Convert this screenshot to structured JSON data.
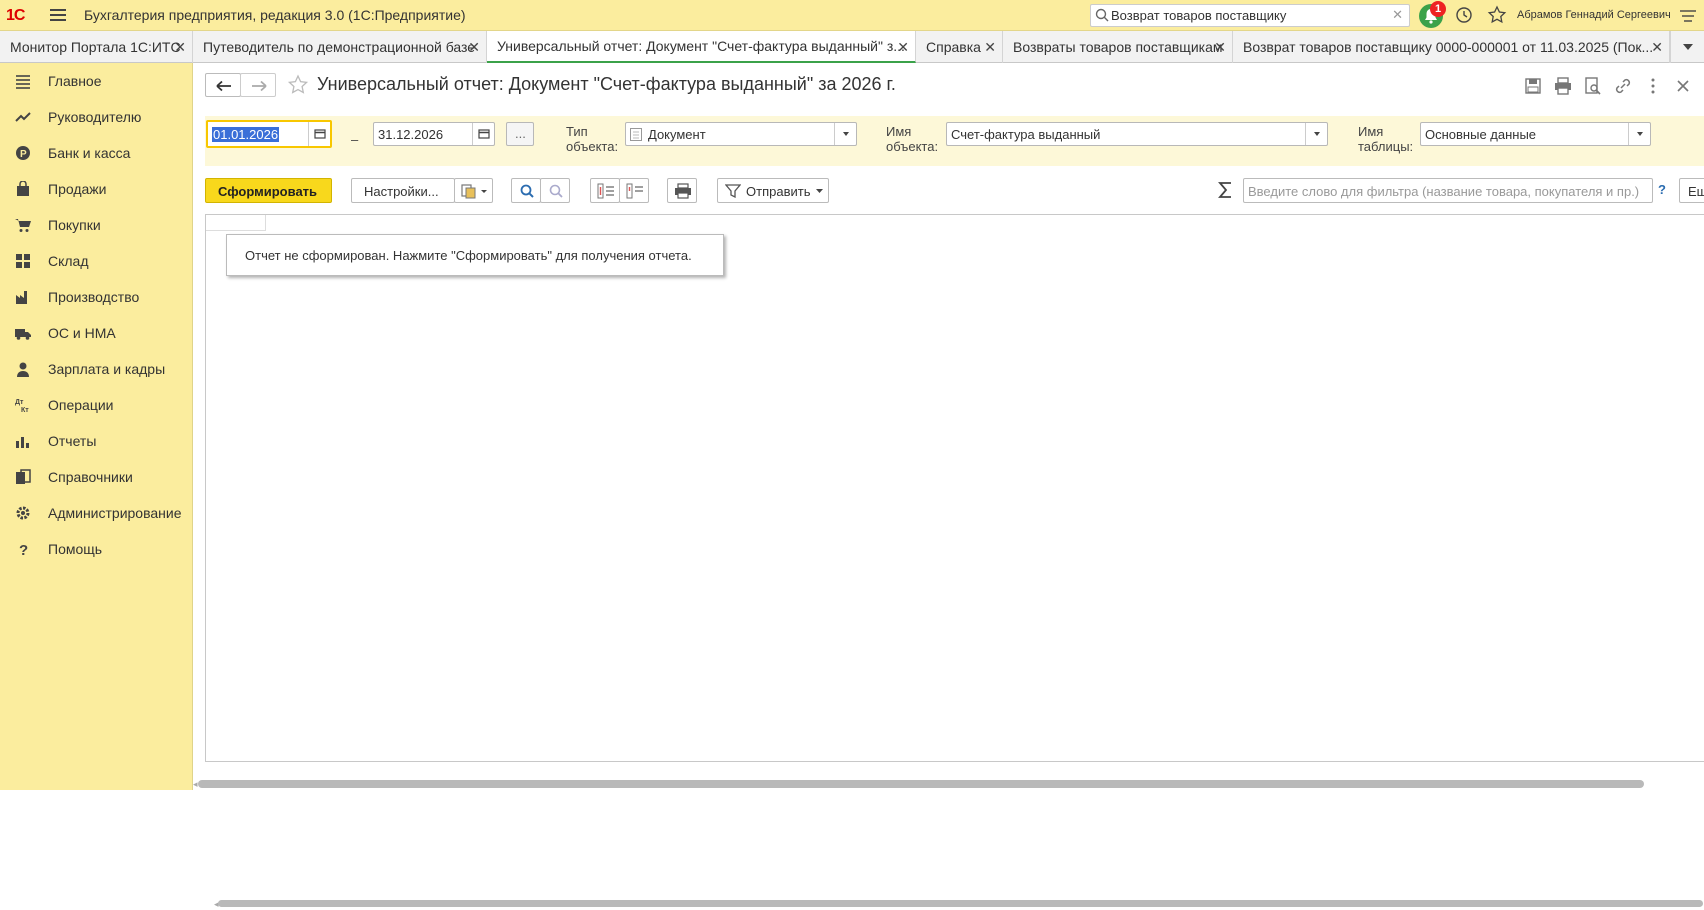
{
  "app": {
    "logo": "1С",
    "title": "Бухгалтерия предприятия, редакция 3.0  (1С:Предприятие)",
    "search_value": "Возврат товаров поставщику",
    "notifications_count": "1",
    "user": "Абрамов Геннадий Сергеевич"
  },
  "tabs": [
    {
      "label": "Монитор Портала 1С:ИТС"
    },
    {
      "label": "Путеводитель по демонстрационной базе"
    },
    {
      "label": "Универсальный отчет: Документ \"Счет-фактура выданный\" з..."
    },
    {
      "label": "Справка"
    },
    {
      "label": "Возвраты товаров поставщикам"
    },
    {
      "label": "Возврат товаров поставщику 0000-000001 от 11.03.2025 (Пок..."
    }
  ],
  "sidebar": {
    "items": [
      {
        "label": "Главное",
        "icon": "list-icon"
      },
      {
        "label": "Руководителю",
        "icon": "trend-icon"
      },
      {
        "label": "Банк и касса",
        "icon": "coin-icon"
      },
      {
        "label": "Продажи",
        "icon": "bag-icon"
      },
      {
        "label": "Покупки",
        "icon": "cart-icon"
      },
      {
        "label": "Склад",
        "icon": "grid-icon"
      },
      {
        "label": "Производство",
        "icon": "factory-icon"
      },
      {
        "label": "ОС и НМА",
        "icon": "truck-icon"
      },
      {
        "label": "Зарплата и кадры",
        "icon": "person-icon"
      },
      {
        "label": "Операции",
        "icon": "ops-icon"
      },
      {
        "label": "Отчеты",
        "icon": "bars-icon"
      },
      {
        "label": "Справочники",
        "icon": "books-icon"
      },
      {
        "label": "Администрирование",
        "icon": "gear-icon"
      },
      {
        "label": "Помощь",
        "icon": "question-icon"
      }
    ]
  },
  "form": {
    "title": "Универсальный отчет: Документ \"Счет-фактура выданный\" за 2026 г.",
    "date_from": "01.01.2026",
    "date_dash": "–",
    "date_to": "31.12.2026",
    "period_btn": "...",
    "object_type_label": "Тип\nобъекта:",
    "object_type": "Документ",
    "object_name_label": "Имя\nобъекта:",
    "object_name": "Счет-фактура выданный",
    "table_name_label": "Имя\nтаблицы:",
    "table_name": "Основные данные"
  },
  "toolbar": {
    "generate": "Сформировать",
    "settings": "Настройки...",
    "send": "Отправить",
    "filter_placeholder": "Введите слово для фильтра (название товара, покупателя и пр.)",
    "help": "?",
    "more": "Ещ"
  },
  "report": {
    "message": "Отчет не сформирован. Нажмите \"Сформировать\" для получения отчета."
  },
  "colors": {
    "accent_yellow": "#fbed9e",
    "primary_button": "#f8d81c",
    "active_tab_underline": "#3ba24a"
  }
}
